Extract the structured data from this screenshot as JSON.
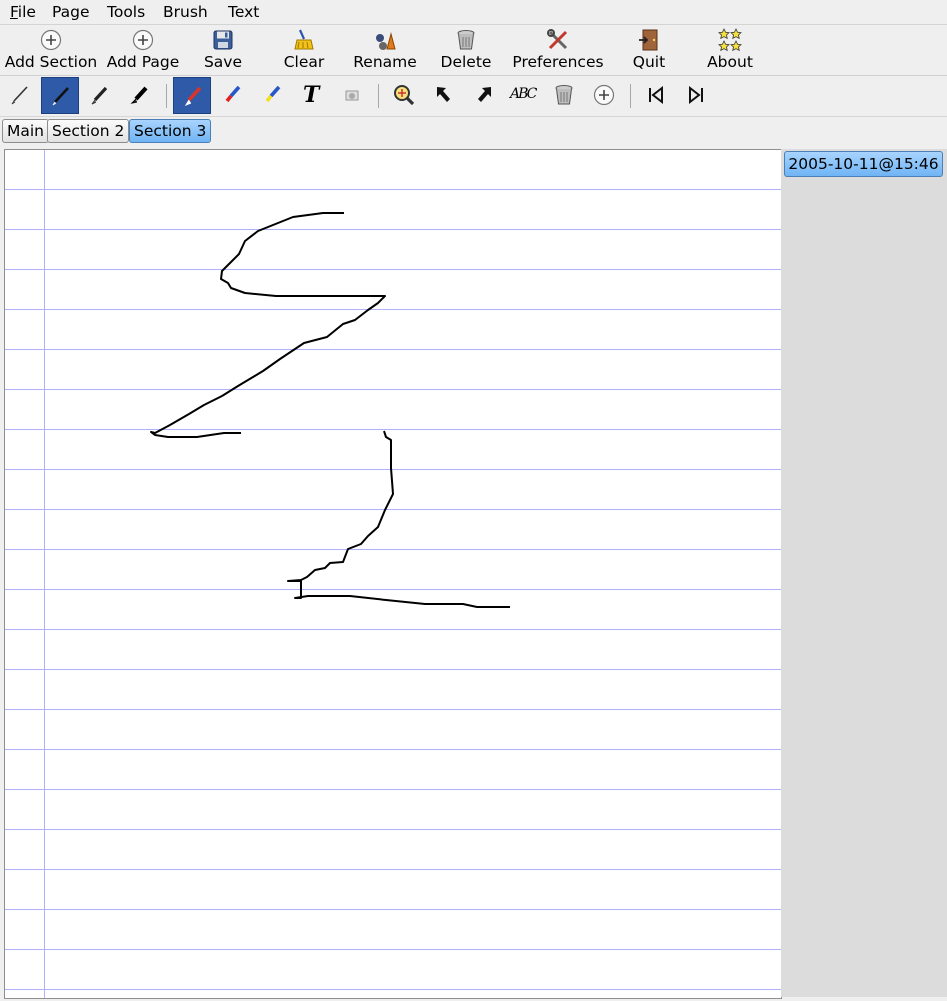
{
  "menu": {
    "file": {
      "mnemonic": "F",
      "rest": "ile"
    },
    "page": "Page",
    "tools": "Tools",
    "brush": "Brush",
    "text": "Text"
  },
  "toolbar": {
    "add_section": "Add Section",
    "add_page": "Add Page",
    "save": "Save",
    "clear": "Clear",
    "rename": "Rename",
    "delete": "Delete",
    "preferences": "Preferences",
    "quit": "Quit",
    "about": "About"
  },
  "tools": {
    "text_tool_glyph": "T",
    "spell_glyph": "ABC"
  },
  "tabs": [
    "Main",
    "Section 2",
    "Section 3"
  ],
  "active_tab": "Section 3",
  "pages": [
    "2005-10-11@15:46"
  ],
  "colors": {
    "accent": "#2e5aa8",
    "tab_active": "#8ec6fb",
    "rule": "#b0b0ff"
  }
}
